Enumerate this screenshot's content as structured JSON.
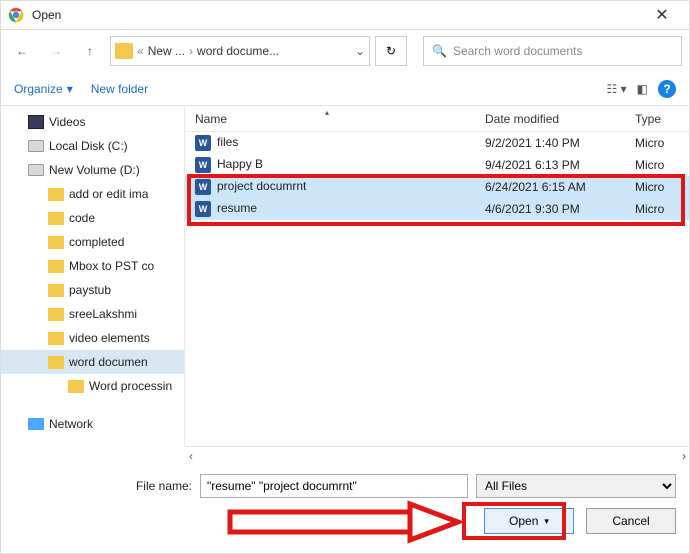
{
  "title": "Open",
  "nav": {
    "crumb1": "New ...",
    "crumb2": "word docume..."
  },
  "search": {
    "placeholder": "Search word documents"
  },
  "toolbar": {
    "organize": "Organize",
    "newfolder": "New folder"
  },
  "tree": [
    {
      "label": "Videos",
      "icon": "video",
      "lvl": "lvl1"
    },
    {
      "label": "Local Disk (C:)",
      "icon": "disk",
      "lvl": "lvl1"
    },
    {
      "label": "New Volume (D:)",
      "icon": "disk",
      "lvl": "lvl1"
    },
    {
      "label": "add or edit ima",
      "icon": "folder",
      "lvl": "lvl2"
    },
    {
      "label": "code",
      "icon": "folder",
      "lvl": "lvl2"
    },
    {
      "label": "completed",
      "icon": "folder",
      "lvl": "lvl2"
    },
    {
      "label": "Mbox to PST co",
      "icon": "folder",
      "lvl": "lvl2"
    },
    {
      "label": "paystub",
      "icon": "folder",
      "lvl": "lvl2"
    },
    {
      "label": "sreeLakshmi",
      "icon": "folder",
      "lvl": "lvl2"
    },
    {
      "label": "video elements",
      "icon": "folder",
      "lvl": "lvl2"
    },
    {
      "label": "word documen",
      "icon": "folder",
      "lvl": "lvl2",
      "sel": true
    },
    {
      "label": "Word processin",
      "icon": "folder",
      "lvl": "lvl3"
    },
    {
      "label": "Network",
      "icon": "net",
      "lvl": "lvl1",
      "gap": true
    }
  ],
  "columns": {
    "name": "Name",
    "date": "Date modified",
    "type": "Type"
  },
  "files": [
    {
      "name": "files",
      "date": "9/2/2021 1:40 PM",
      "type": "Micro",
      "selected": false
    },
    {
      "name": "Happy B",
      "date": "9/4/2021 6:13 PM",
      "type": "Micro",
      "selected": false
    },
    {
      "name": "project documrnt",
      "date": "6/24/2021 6:15 AM",
      "type": "Micro",
      "selected": true
    },
    {
      "name": "resume",
      "date": "4/6/2021 9:30 PM",
      "type": "Micro",
      "selected": true
    }
  ],
  "filename": {
    "label": "File name:",
    "value": "\"resume\" \"project documrnt\""
  },
  "filter": {
    "value": "All Files"
  },
  "buttons": {
    "open": "Open",
    "cancel": "Cancel"
  }
}
